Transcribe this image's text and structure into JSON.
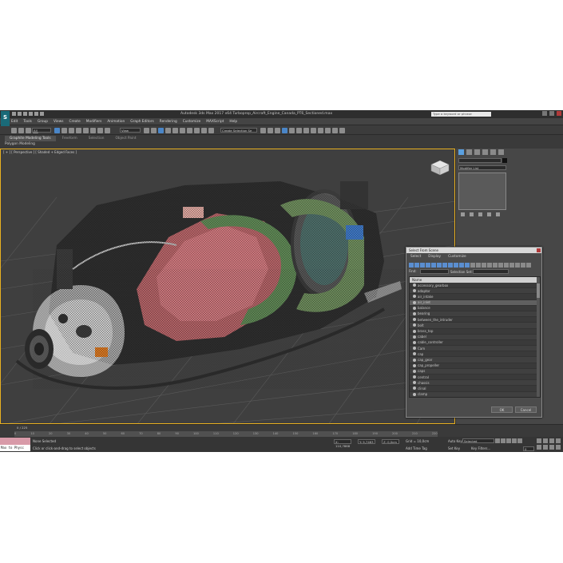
{
  "app": {
    "logo": "S",
    "title": "Autodesk 3ds Max 2017 x64    Turboprop_Aircraft_Engine_Canada_PT6_Sectioned.max",
    "search_placeholder": "Type a keyword or phrase"
  },
  "menu": [
    "Edit",
    "Tools",
    "Group",
    "Views",
    "Create",
    "Modifiers",
    "Animation",
    "Graph Editors",
    "Rendering",
    "Customize",
    "MAXScript",
    "Help"
  ],
  "toolbar": {
    "filter_value": "All",
    "view_value": "View",
    "selection_set": "Create Selection Se"
  },
  "ribbon": {
    "tabs": [
      "Graphite Modeling Tools",
      "Freeform",
      "Selection",
      "Object Paint"
    ],
    "sub_label": "Polygon Modeling"
  },
  "viewport": {
    "label": "[ + ] [ Perspective ] [ Shaded + Edged Faces ]"
  },
  "command_panel": {
    "modifier_list": "Modifier List"
  },
  "dialog": {
    "title": "Select From Scene",
    "menu": [
      "Select",
      "Display",
      "Customize"
    ],
    "find_label": "Find:",
    "selection_set_label": "Selection Set:",
    "column_header": "Name",
    "items": [
      "accessory_gearbox",
      "adaptor",
      "air_intake",
      "air_inlet",
      "balance",
      "bearing",
      "between_the_intruder",
      "bolt",
      "brass_top",
      "cabel",
      "cable_controller",
      "Cam",
      "cap",
      "cap_gear",
      "cap_propeller",
      "caps",
      "central",
      "chassis",
      "clinal",
      "clamp"
    ],
    "selected_index": 3,
    "ok_label": "OK",
    "cancel_label": "Cancel"
  },
  "timeline": {
    "frame_indicator": "0 / 225",
    "ticks": [
      "0",
      "10",
      "20",
      "30",
      "40",
      "50",
      "60",
      "70",
      "80",
      "90",
      "100",
      "110",
      "120",
      "130",
      "140",
      "150",
      "160",
      "170",
      "180",
      "190",
      "200",
      "210",
      "220"
    ]
  },
  "status": {
    "maxscript_label": "Max to Physc",
    "selection_text": "None Selected",
    "prompt_text": "Click or click-and-drag to select objects",
    "x_value": "X: 110,7868",
    "y_value": "Y: 9,7463",
    "z_value": "Z: 0,0cm",
    "grid_text": "Grid = 10,0cm",
    "add_time_tag": "Add Time Tag",
    "auto_key": "Auto Key",
    "key_mode": "Selected",
    "set_key": "Set Key",
    "key_filters": "Key Filters...",
    "frame_value": "0"
  }
}
